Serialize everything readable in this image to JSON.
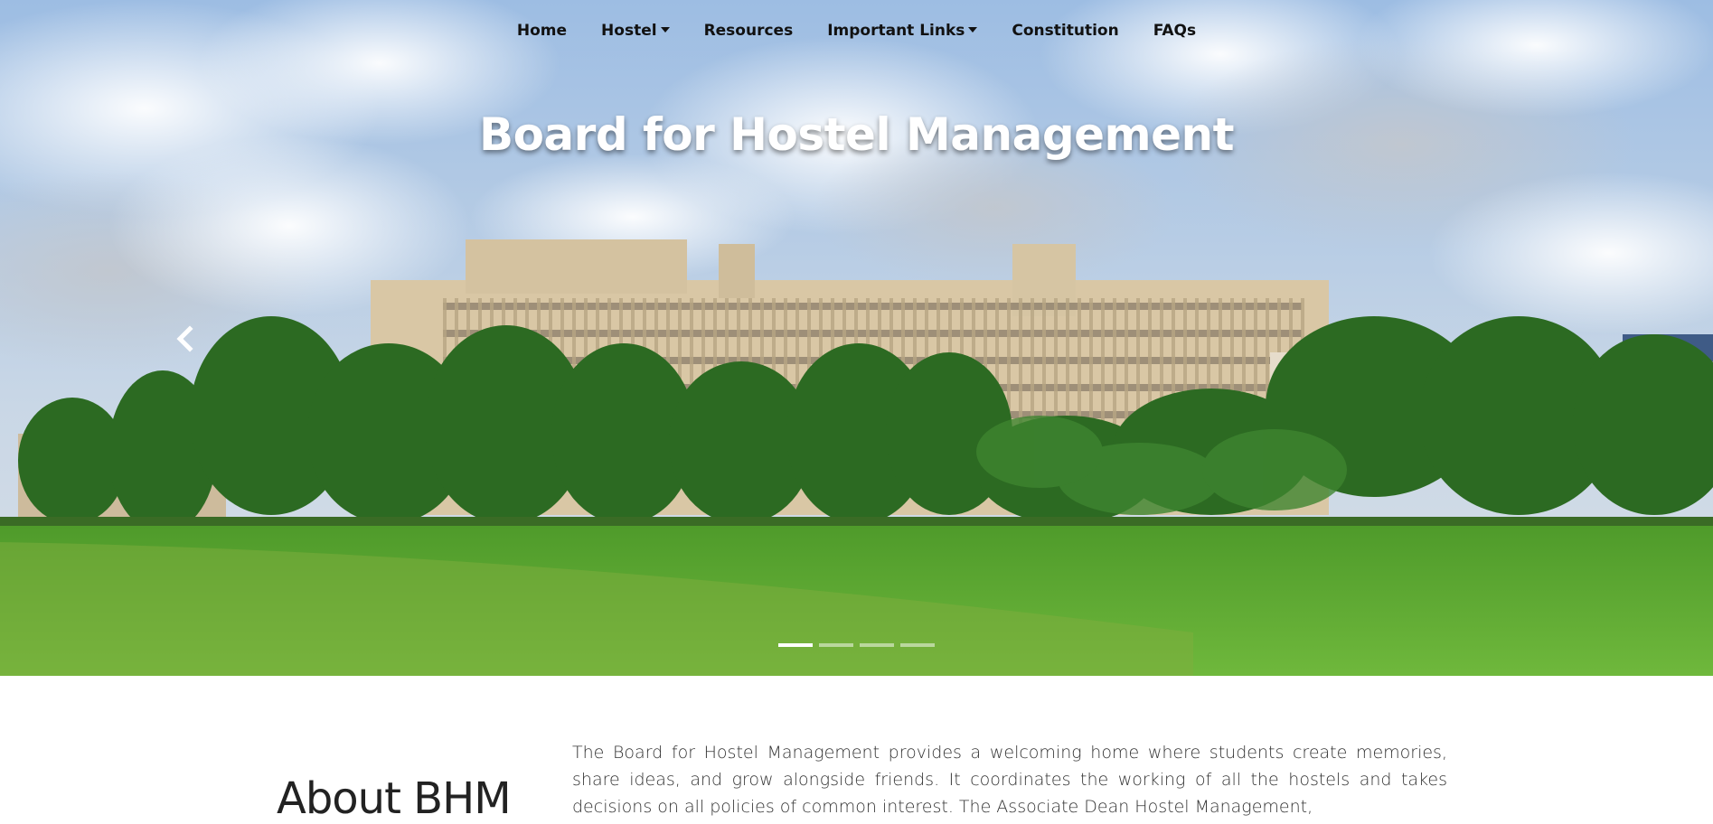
{
  "nav": {
    "items": [
      {
        "label": "Home",
        "dropdown": false
      },
      {
        "label": "Hostel",
        "dropdown": true
      },
      {
        "label": "Resources",
        "dropdown": false
      },
      {
        "label": "Important Links",
        "dropdown": true
      },
      {
        "label": "Constitution",
        "dropdown": false
      },
      {
        "label": "FAQs",
        "dropdown": false
      }
    ]
  },
  "hero": {
    "title": "Board for Hostel Management",
    "carousel": {
      "slide_count": 4,
      "active_index": 0,
      "prev_icon": "chevron-left-icon"
    }
  },
  "about": {
    "title": "About BHM",
    "text": "The Board for Hostel Management provides a welcoming home where students create memories, share ideas, and grow alongside friends. It coordinates the working of all the hostels and takes decisions on all policies of common interest. The Associate Dean Hostel Management,"
  },
  "colors": {
    "sky": "#8fb2dc",
    "grass": "#5aa532",
    "building": "#d9c9a8",
    "trees": "#2f6b26"
  }
}
